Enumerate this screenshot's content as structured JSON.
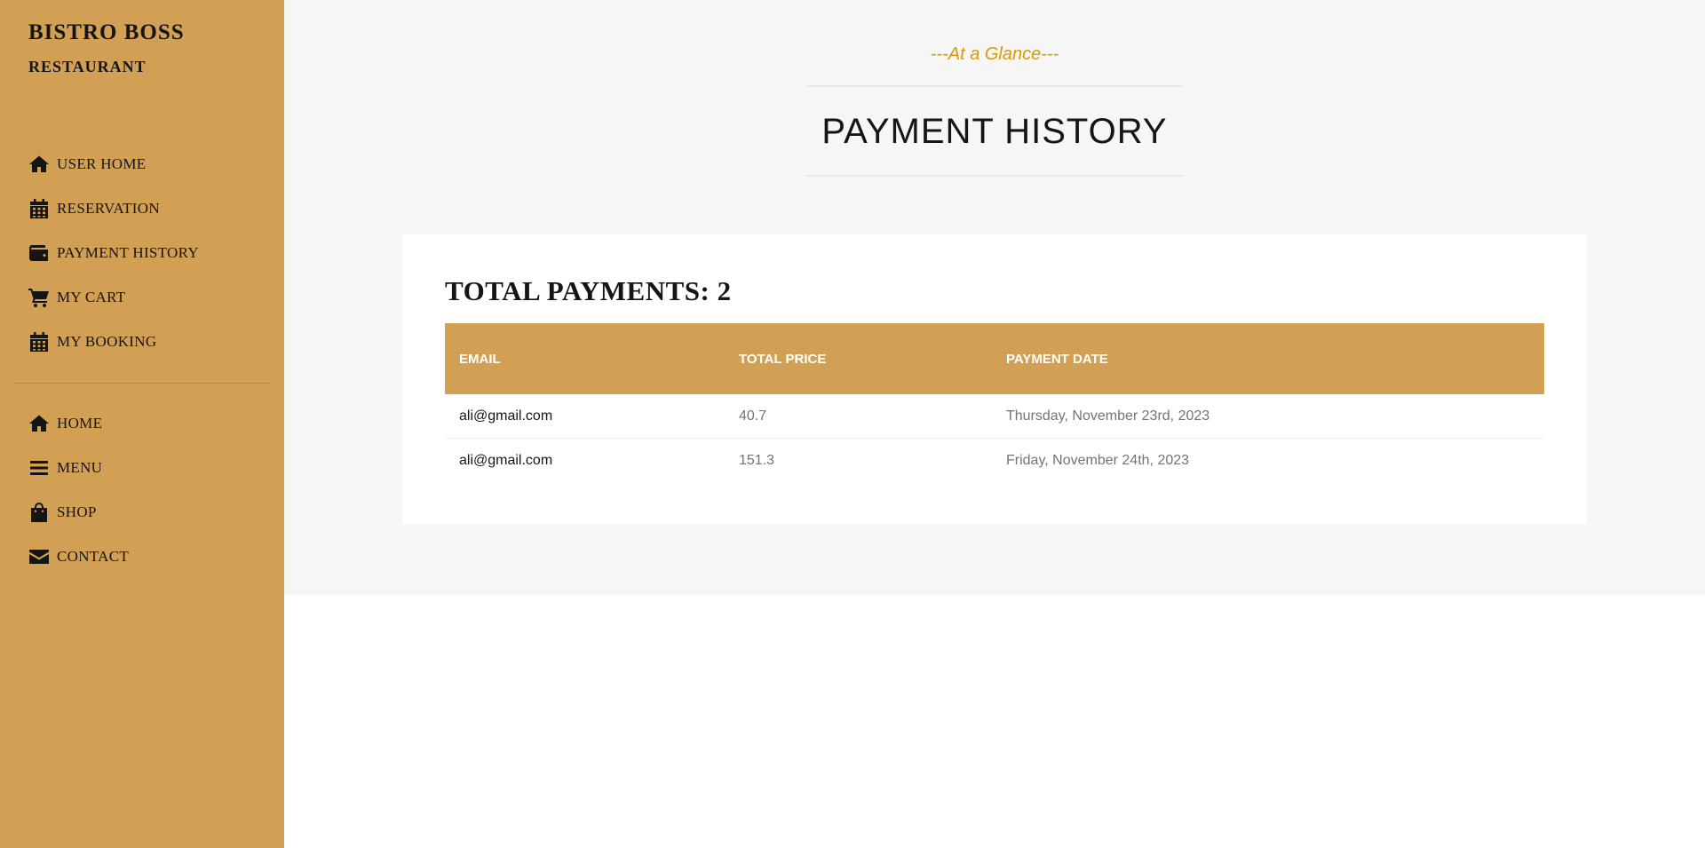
{
  "brand": {
    "title": "BISTRO BOSS",
    "subtitle": "RESTAURANT"
  },
  "sidebar": {
    "items": [
      {
        "label": "User Home",
        "icon": "home-icon"
      },
      {
        "label": "Reservation",
        "icon": "calendar-icon"
      },
      {
        "label": "Payment History",
        "icon": "wallet-icon"
      },
      {
        "label": "My Cart",
        "icon": "cart-icon"
      },
      {
        "label": "My Booking",
        "icon": "calendar-icon"
      }
    ],
    "secondary_items": [
      {
        "label": "Home",
        "icon": "home-icon"
      },
      {
        "label": "Menu",
        "icon": "menu-icon"
      },
      {
        "label": "Shop",
        "icon": "shopping-bag-icon"
      },
      {
        "label": "Contact",
        "icon": "envelope-icon"
      }
    ]
  },
  "section": {
    "subheading": "---At a Glance---",
    "title": "PAYMENT HISTORY"
  },
  "payments": {
    "total_label": "Total Payments: 2",
    "columns": [
      "Email",
      "Total Price",
      "Payment Date"
    ],
    "rows": [
      {
        "email": "ali@gmail.com",
        "price": "40.7",
        "date": "Thursday, November 23rd, 2023"
      },
      {
        "email": "ali@gmail.com",
        "price": "151.3",
        "date": "Friday, November 24th, 2023"
      }
    ]
  },
  "colors": {
    "sidebar": "#D1A054",
    "accent": "#D99904",
    "text": "#151515",
    "muted_text": "#737373",
    "page_bg": "#F6F6F6"
  }
}
